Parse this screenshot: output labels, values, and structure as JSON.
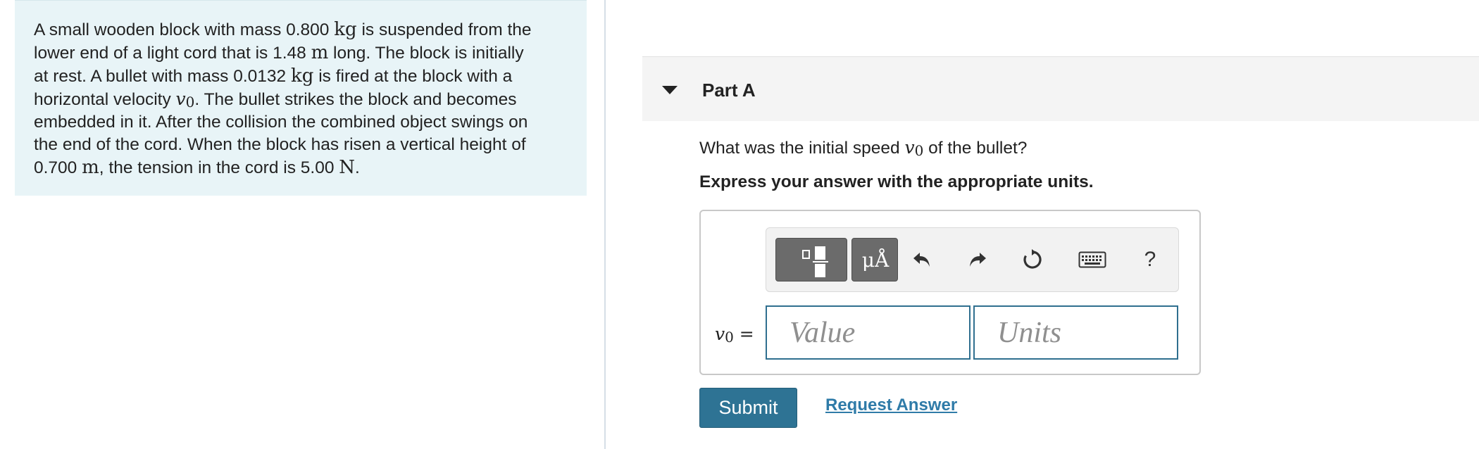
{
  "problem": {
    "lines": [
      [
        "A small wooden block with mass 0.800 ",
        "kg",
        " is suspended from the"
      ],
      [
        "lower end of a light cord that is 1.48 ",
        "m",
        " long. The block is initially"
      ],
      [
        "at rest. A bullet with mass 0.0132 ",
        "kg",
        " is fired at the block with a"
      ],
      [
        "horizontal velocity ",
        "v0",
        ". The bullet strikes the block and becomes"
      ],
      [
        "embedded in it. After the collision the combined object swings on"
      ],
      [
        "the end of the cord. When the block has risen a vertical height of"
      ],
      [
        "0.700 ",
        "m",
        ", the tension in the cord is 5.00 ",
        "N",
        "."
      ]
    ]
  },
  "part": {
    "title": "Part A",
    "question_before": "What was the initial speed ",
    "question_var": "v",
    "question_sub": "0",
    "question_after": " of the bullet?",
    "instruction": "Express your answer with the appropriate units."
  },
  "toolbar": {
    "units_label": "μÅ",
    "help_label": "?"
  },
  "answer": {
    "var": "v",
    "var_sub": "0",
    "equals": " =",
    "value_placeholder": "Value",
    "units_placeholder": "Units"
  },
  "actions": {
    "submit_label": "Submit",
    "request_label": "Request Answer"
  },
  "colors": {
    "panel_bg": "#e8f4f7",
    "accent": "#2e7394",
    "link": "#2f7ba8"
  }
}
